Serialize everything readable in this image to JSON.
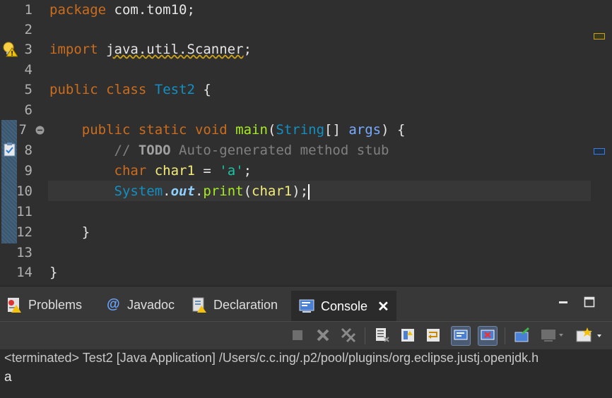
{
  "editor": {
    "line_numbers": [
      "1",
      "2",
      "3",
      "4",
      "5",
      "6",
      "7",
      "8",
      "9",
      "10",
      "11",
      "12",
      "13",
      "14"
    ],
    "lines": {
      "l1": {
        "kw": "package",
        "rest": " com.tom10;"
      },
      "l3": {
        "kw": "import",
        "sp": " ",
        "pkg": "java.util.Scanner",
        "semi": ";"
      },
      "l5": {
        "kw1": "public",
        "kw2": "class",
        "name": "Test2",
        "brace": " {"
      },
      "l7": {
        "kw1": "public",
        "kw2": "static",
        "kw3": "void",
        "meth": "main",
        "open": "(",
        "type": "String",
        "arr": "[] ",
        "param": "args",
        "close": ") {"
      },
      "l8": {
        "slashes": "// ",
        "todo": "TODO",
        "rest": " Auto-generated method stub"
      },
      "l9": {
        "kw": "char",
        "var": "char1",
        "eq": " = ",
        "str": "'a'",
        "semi": ";"
      },
      "l10": {
        "type": "System",
        "dot1": ".",
        "fld": "out",
        "dot2": ".",
        "meth": "print",
        "open": "(",
        "var": "char1",
        "close": ");"
      },
      "l12": {
        "brace": "}"
      },
      "l14": {
        "brace": "}"
      }
    }
  },
  "panel": {
    "tabs": [
      {
        "label": "Problems"
      },
      {
        "label": "Javadoc"
      },
      {
        "label": "Declaration"
      },
      {
        "label": "Console"
      }
    ],
    "console": {
      "status": "<terminated> Test2 [Java Application] /Users/c.c.ing/.p2/pool/plugins/org.eclipse.justj.openjdk.h",
      "output": "a"
    }
  },
  "colors": {
    "keyword": "#cc6c1d",
    "type": "#1290c3",
    "method": "#a7ec21",
    "string": "#17c6a3",
    "local": "#f3ec79",
    "comment": "#808080"
  }
}
